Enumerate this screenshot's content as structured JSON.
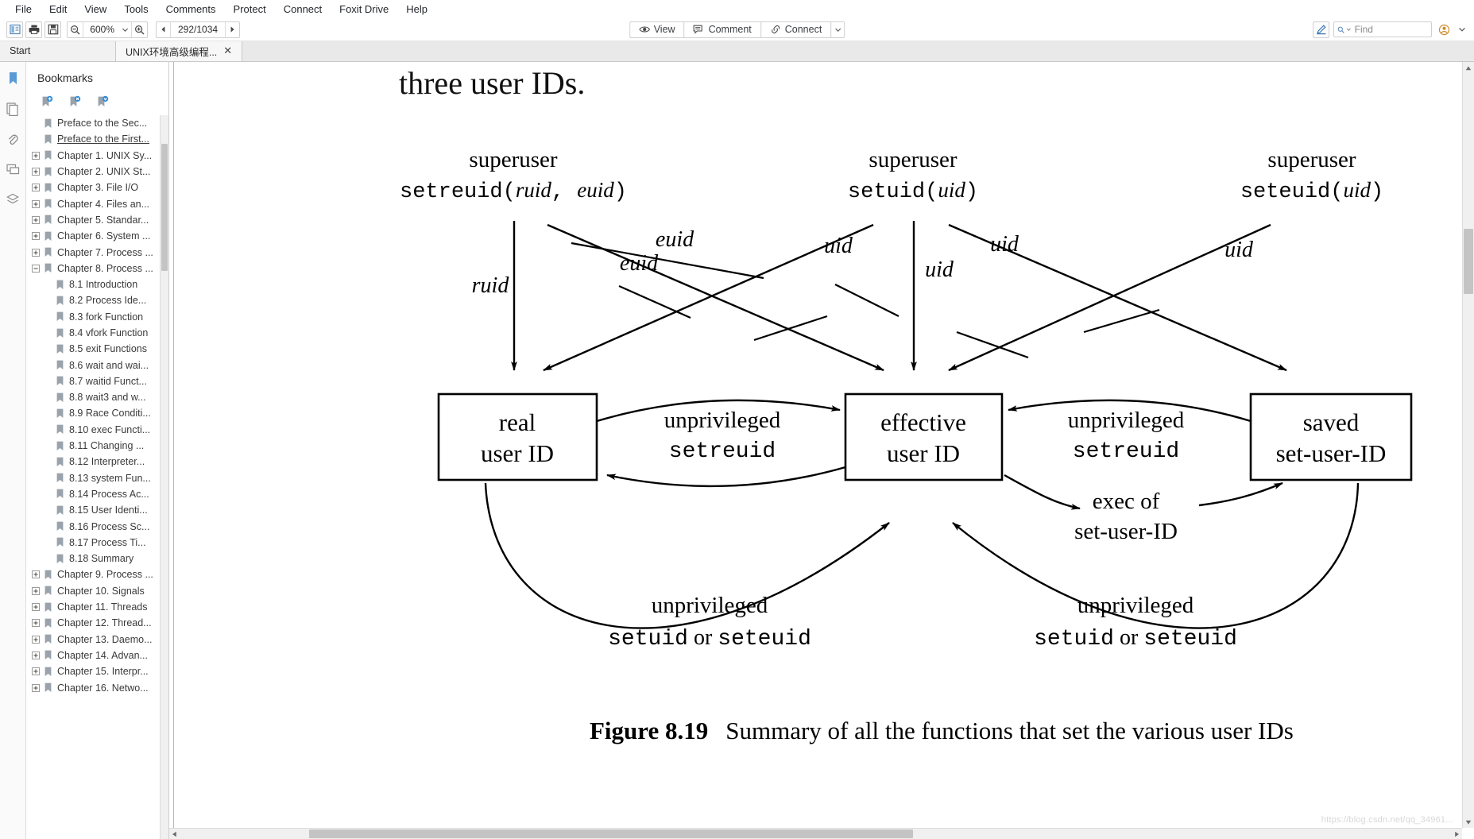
{
  "menubar": {
    "items": [
      "File",
      "Edit",
      "View",
      "Tools",
      "Comments",
      "Protect",
      "Connect",
      "Foxit Drive",
      "Help"
    ]
  },
  "toolbar": {
    "sidebar_toggle": "sidebar-icon",
    "print": "print-icon",
    "save": "save-icon",
    "zoom_out": "zoom-out-icon",
    "zoom_value": "600%",
    "zoom_in": "zoom-in-icon",
    "prev_page": "prev-page-icon",
    "page_value": "292/1034",
    "next_page": "next-page-icon",
    "view_label": "View",
    "comment_label": "Comment",
    "connect_label": "Connect",
    "pen_icon": "pen-icon",
    "find_placeholder": "Find",
    "find_value": "",
    "account_label": "account-icon"
  },
  "tabs": [
    {
      "label": "Start",
      "closable": false,
      "active": false
    },
    {
      "label": "UNIX环境高级编程...",
      "closable": true,
      "active": true,
      "close": "✕"
    }
  ],
  "rail": [
    {
      "name": "bookmark-panel-icon"
    },
    {
      "name": "pages-panel-icon"
    },
    {
      "name": "attachments-panel-icon"
    },
    {
      "name": "comments-panel-icon"
    },
    {
      "name": "layers-panel-icon"
    }
  ],
  "bookmarks": {
    "title": "Bookmarks",
    "tools": [
      "add-bookmark-icon",
      "delete-bookmark-icon",
      "bookmark-options-icon"
    ],
    "items": [
      {
        "label": "Preface to the Sec...",
        "level": 1,
        "expander": "none",
        "selected": false
      },
      {
        "label": "Preface to the First...",
        "level": 1,
        "expander": "none",
        "selected": true
      },
      {
        "label": "Chapter 1. UNIX Sy...",
        "level": 1,
        "expander": "plus",
        "selected": false
      },
      {
        "label": "Chapter 2. UNIX St...",
        "level": 1,
        "expander": "plus",
        "selected": false
      },
      {
        "label": "Chapter 3. File I/O",
        "level": 1,
        "expander": "plus",
        "selected": false
      },
      {
        "label": "Chapter 4. Files an...",
        "level": 1,
        "expander": "plus",
        "selected": false
      },
      {
        "label": "Chapter 5. Standar...",
        "level": 1,
        "expander": "plus",
        "selected": false
      },
      {
        "label": "Chapter 6. System ...",
        "level": 1,
        "expander": "plus",
        "selected": false
      },
      {
        "label": "Chapter 7. Process ...",
        "level": 1,
        "expander": "plus",
        "selected": false
      },
      {
        "label": "Chapter 8. Process ...",
        "level": 1,
        "expander": "minus",
        "selected": false
      },
      {
        "label": "8.1 Introduction",
        "level": 2,
        "expander": "none",
        "selected": false
      },
      {
        "label": "8.2 Process Ide...",
        "level": 2,
        "expander": "none",
        "selected": false
      },
      {
        "label": "8.3 fork Function",
        "level": 2,
        "expander": "none",
        "selected": false
      },
      {
        "label": "8.4 vfork Function",
        "level": 2,
        "expander": "none",
        "selected": false
      },
      {
        "label": "8.5 exit Functions",
        "level": 2,
        "expander": "none",
        "selected": false
      },
      {
        "label": "8.6 wait and wai...",
        "level": 2,
        "expander": "none",
        "selected": false
      },
      {
        "label": "8.7 waitid Funct...",
        "level": 2,
        "expander": "none",
        "selected": false
      },
      {
        "label": "8.8 wait3 and w...",
        "level": 2,
        "expander": "none",
        "selected": false
      },
      {
        "label": "8.9 Race Conditi...",
        "level": 2,
        "expander": "none",
        "selected": false
      },
      {
        "label": "8.10 exec Functi...",
        "level": 2,
        "expander": "none",
        "selected": false
      },
      {
        "label": "8.11 Changing ...",
        "level": 2,
        "expander": "none",
        "selected": false
      },
      {
        "label": "8.12 Interpreter...",
        "level": 2,
        "expander": "none",
        "selected": false
      },
      {
        "label": "8.13 system Fun...",
        "level": 2,
        "expander": "none",
        "selected": false
      },
      {
        "label": "8.14 Process Ac...",
        "level": 2,
        "expander": "none",
        "selected": false
      },
      {
        "label": "8.15 User Identi...",
        "level": 2,
        "expander": "none",
        "selected": false
      },
      {
        "label": "8.16 Process Sc...",
        "level": 2,
        "expander": "none",
        "selected": false
      },
      {
        "label": "8.17 Process Ti...",
        "level": 2,
        "expander": "none",
        "selected": false
      },
      {
        "label": "8.18 Summary",
        "level": 2,
        "expander": "none",
        "selected": false
      },
      {
        "label": "Chapter 9. Process ...",
        "level": 1,
        "expander": "plus",
        "selected": false
      },
      {
        "label": "Chapter 10. Signals",
        "level": 1,
        "expander": "plus",
        "selected": false
      },
      {
        "label": "Chapter 11. Threads",
        "level": 1,
        "expander": "plus",
        "selected": false
      },
      {
        "label": "Chapter 12. Thread...",
        "level": 1,
        "expander": "plus",
        "selected": false
      },
      {
        "label": "Chapter 13. Daemo...",
        "level": 1,
        "expander": "plus",
        "selected": false
      },
      {
        "label": "Chapter 14. Advan...",
        "level": 1,
        "expander": "plus",
        "selected": false
      },
      {
        "label": "Chapter 15. Interpr...",
        "level": 1,
        "expander": "plus",
        "selected": false
      },
      {
        "label": "Chapter 16. Netwo...",
        "level": 1,
        "expander": "plus",
        "selected": false
      }
    ]
  },
  "document": {
    "clipped_top_text": "three user IDs.",
    "caption_bold": "Figure 8.19",
    "caption_text": "Summary of all the functions that set the various user IDs",
    "watermark": "https://blog.csdn.net/qq_34961...",
    "diagram": {
      "columns": [
        {
          "role_label": "superuser",
          "call_prefix": "setreuid(",
          "call_arg1": "ruid",
          "call_mid": ", ",
          "call_arg2": "euid",
          "call_suffix": ")"
        },
        {
          "role_label": "superuser",
          "call_prefix": "setuid(",
          "call_arg1": "uid",
          "call_suffix": ")"
        },
        {
          "role_label": "superuser",
          "call_prefix": "seteuid(",
          "call_arg1": "uid",
          "call_suffix": ")"
        }
      ],
      "arrow_labels": [
        "ruid",
        "euid",
        "euid",
        "uid",
        "uid",
        "uid",
        "uid"
      ],
      "boxes": [
        {
          "line1": "real",
          "line2": "user ID"
        },
        {
          "line1": "effective",
          "line2": "user ID"
        },
        {
          "line1": "saved",
          "line2": "set-user-ID"
        }
      ],
      "edge_labels": [
        {
          "line1": "unprivileged",
          "line2": "setreuid"
        },
        {
          "line1": "unprivileged",
          "line2": "setreuid"
        },
        {
          "line1": "exec of",
          "line2": "set-user-ID"
        },
        {
          "line1": "unprivileged",
          "line2_a": "setuid",
          "line2_b": " or ",
          "line2_c": "seteuid"
        },
        {
          "line1": "unprivileged",
          "line2_a": "setuid",
          "line2_b": " or ",
          "line2_c": "seteuid"
        }
      ]
    }
  }
}
